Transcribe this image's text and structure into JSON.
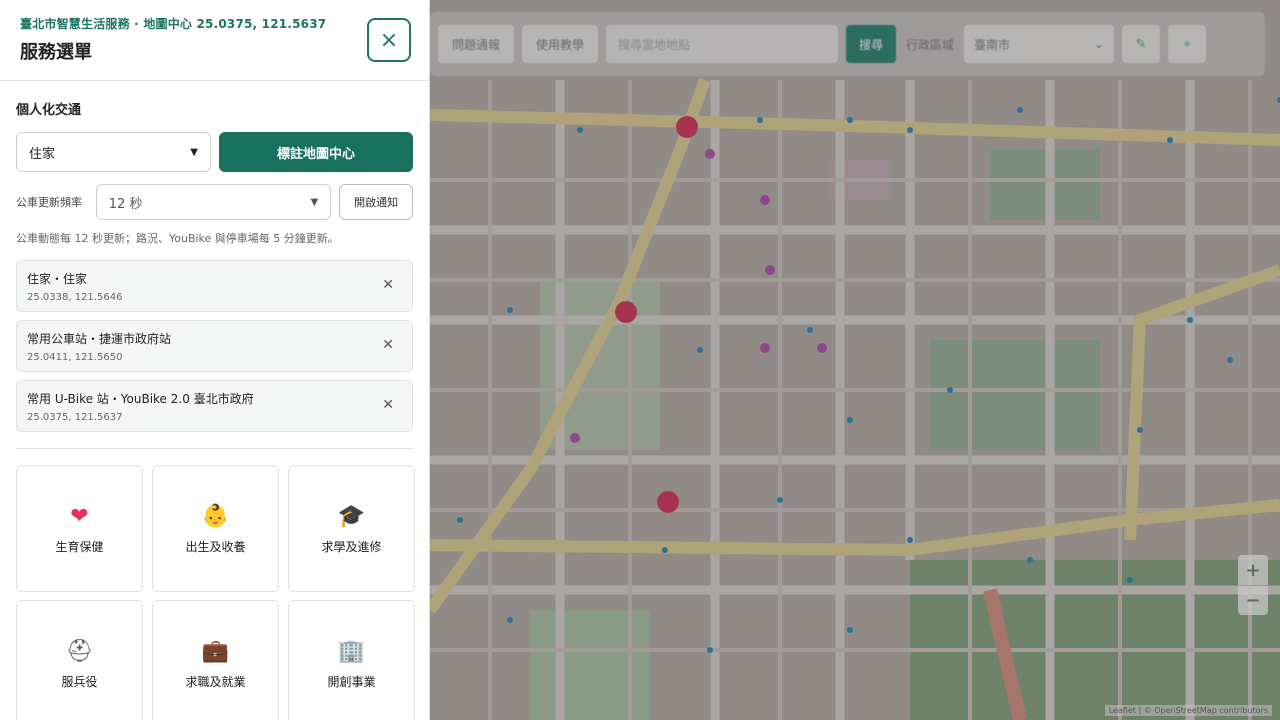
{
  "panel": {
    "subtitle": "臺北市智慧生活服務 · 地圖中心 25.0375, 121.5637",
    "title": "服務選單",
    "close_icon": "×",
    "section_label": "個人化交通",
    "place_select_value": "住家",
    "mark_center_label": "標註地圖中心",
    "freq_label": "公車更新頻率",
    "freq_value": "12 秒",
    "notify_label": "開啟通知",
    "note": "公車動態每 12 秒更新；路況、YouBike 與停車場每 5 分鐘更新。",
    "favorites": [
      {
        "title": "住家・住家",
        "coord": "25.0338, 121.5646"
      },
      {
        "title": "常用公車站・捷運市政府站",
        "coord": "25.0411, 121.5650"
      },
      {
        "title": "常用 U-Bike 站・YouBike 2.0 臺北市政府",
        "coord": "25.0375, 121.5637"
      }
    ],
    "remove_icon": "✕",
    "services": [
      {
        "icon": "❤",
        "icon_name": "heart-icon",
        "label": "生育保健",
        "color": "#e5335d"
      },
      {
        "icon": "👶",
        "icon_name": "baby-icon",
        "label": "出生及收養",
        "color": "#f2b33d"
      },
      {
        "icon": "🎓",
        "icon_name": "graduation-cap-icon",
        "label": "求學及進修",
        "color": "#333333"
      },
      {
        "icon": "⛑",
        "icon_name": "helmet-icon",
        "label": "服兵役",
        "color": "#3f6b3a"
      },
      {
        "icon": "💼",
        "icon_name": "briefcase-icon",
        "label": "求職及就業",
        "color": "#8b4a2b"
      },
      {
        "icon": "🏢",
        "icon_name": "building-icon",
        "label": "開創事業",
        "color": "#5b7fa6"
      }
    ]
  },
  "map": {
    "toolbar": {
      "btn1": "問題通報",
      "btn2": "使用教學",
      "search_placeholder": "搜尋當地地點",
      "search_button": "搜尋",
      "district_label": "行政區域",
      "district_value": "臺南市"
    },
    "zoom_in": "+",
    "zoom_out": "−",
    "attribution": "Leaflet | © OpenStreetMap contributors"
  },
  "colors": {
    "accent": "#18705f",
    "accent_text": "#1e7563"
  }
}
